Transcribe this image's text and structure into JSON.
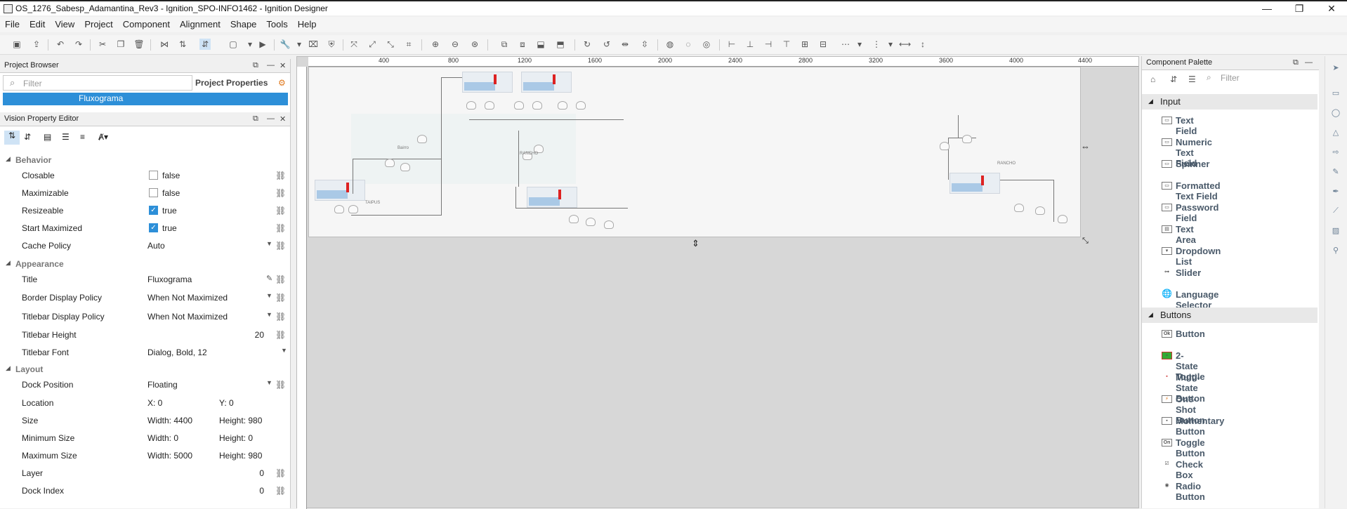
{
  "window": {
    "title": "OS_1276_Sabesp_Adamantina_Rev3 - Ignition_SPO-INFO1462 - Ignition Designer",
    "minimize": "—",
    "maximize": "❐",
    "close": "✕"
  },
  "menu": [
    "File",
    "Edit",
    "View",
    "Project",
    "Component",
    "Alignment",
    "Shape",
    "Tools",
    "Help"
  ],
  "project_browser": {
    "title": "Project Browser",
    "filter_placeholder": "Filter",
    "props_button": "Project Properties",
    "selected_item": "Fluxograma"
  },
  "property_editor": {
    "title": "Vision Property Editor",
    "sections": {
      "behavior": "Behavior",
      "appearance": "Appearance",
      "layout": "Layout"
    },
    "closable": {
      "name": "Closable",
      "value": "false",
      "checked": false
    },
    "maximizable": {
      "name": "Maximizable",
      "value": "false",
      "checked": false
    },
    "resizeable": {
      "name": "Resizeable",
      "value": "true",
      "checked": true
    },
    "start_maximized": {
      "name": "Start Maximized",
      "value": "true",
      "checked": true
    },
    "cache_policy": {
      "name": "Cache Policy",
      "value": "Auto"
    },
    "title_prop": {
      "name": "Title",
      "value": "Fluxograma"
    },
    "border_display_policy": {
      "name": "Border Display Policy",
      "value": "When Not Maximized"
    },
    "titlebar_display_policy": {
      "name": "Titlebar Display Policy",
      "value": "When Not Maximized"
    },
    "titlebar_height": {
      "name": "Titlebar Height",
      "value": "20"
    },
    "titlebar_font": {
      "name": "Titlebar Font",
      "value": "Dialog, Bold, 12"
    },
    "dock_position": {
      "name": "Dock Position",
      "value": "Floating"
    },
    "location": {
      "name": "Location",
      "x": "X: 0",
      "y": "Y: 0"
    },
    "size": {
      "name": "Size",
      "w": "Width: 4400",
      "h": "Height: 980"
    },
    "min_size": {
      "name": "Minimum Size",
      "w": "Width: 0",
      "h": "Height: 0"
    },
    "max_size": {
      "name": "Maximum Size",
      "w": "Width: 5000",
      "h": "Height: 980"
    },
    "layer": {
      "name": "Layer",
      "value": "0"
    },
    "dock_index": {
      "name": "Dock Index",
      "value": "0"
    }
  },
  "ruler": {
    "h_ticks": [
      "400",
      "800",
      "1200",
      "1600",
      "2000",
      "2400",
      "2800",
      "3200",
      "3600",
      "4000",
      "4400"
    ]
  },
  "canvas_labels": {
    "rancho1": "RANCHO",
    "rancho2": "RANCHO",
    "taipus": "TAIPUS",
    "bairro": "Bairro"
  },
  "component_palette": {
    "title": "Component Palette",
    "filter_placeholder": "Filter",
    "sections": {
      "input": "Input",
      "buttons": "Buttons"
    },
    "input_items": [
      "Text Field",
      "Numeric Text Field",
      "Spinner",
      "Formatted Text Field",
      "Password Field",
      "Text Area",
      "Dropdown List",
      "Slider",
      "Language Selector"
    ],
    "button_items": [
      "Button",
      "2-State Toggle",
      "Multi-State Button",
      "One-Shot Button",
      "Momentary Button",
      "Toggle Button",
      "Check Box",
      "Radio Button"
    ]
  },
  "icons": {
    "filter": "⌕",
    "link": "⛓",
    "edit": "✎"
  }
}
